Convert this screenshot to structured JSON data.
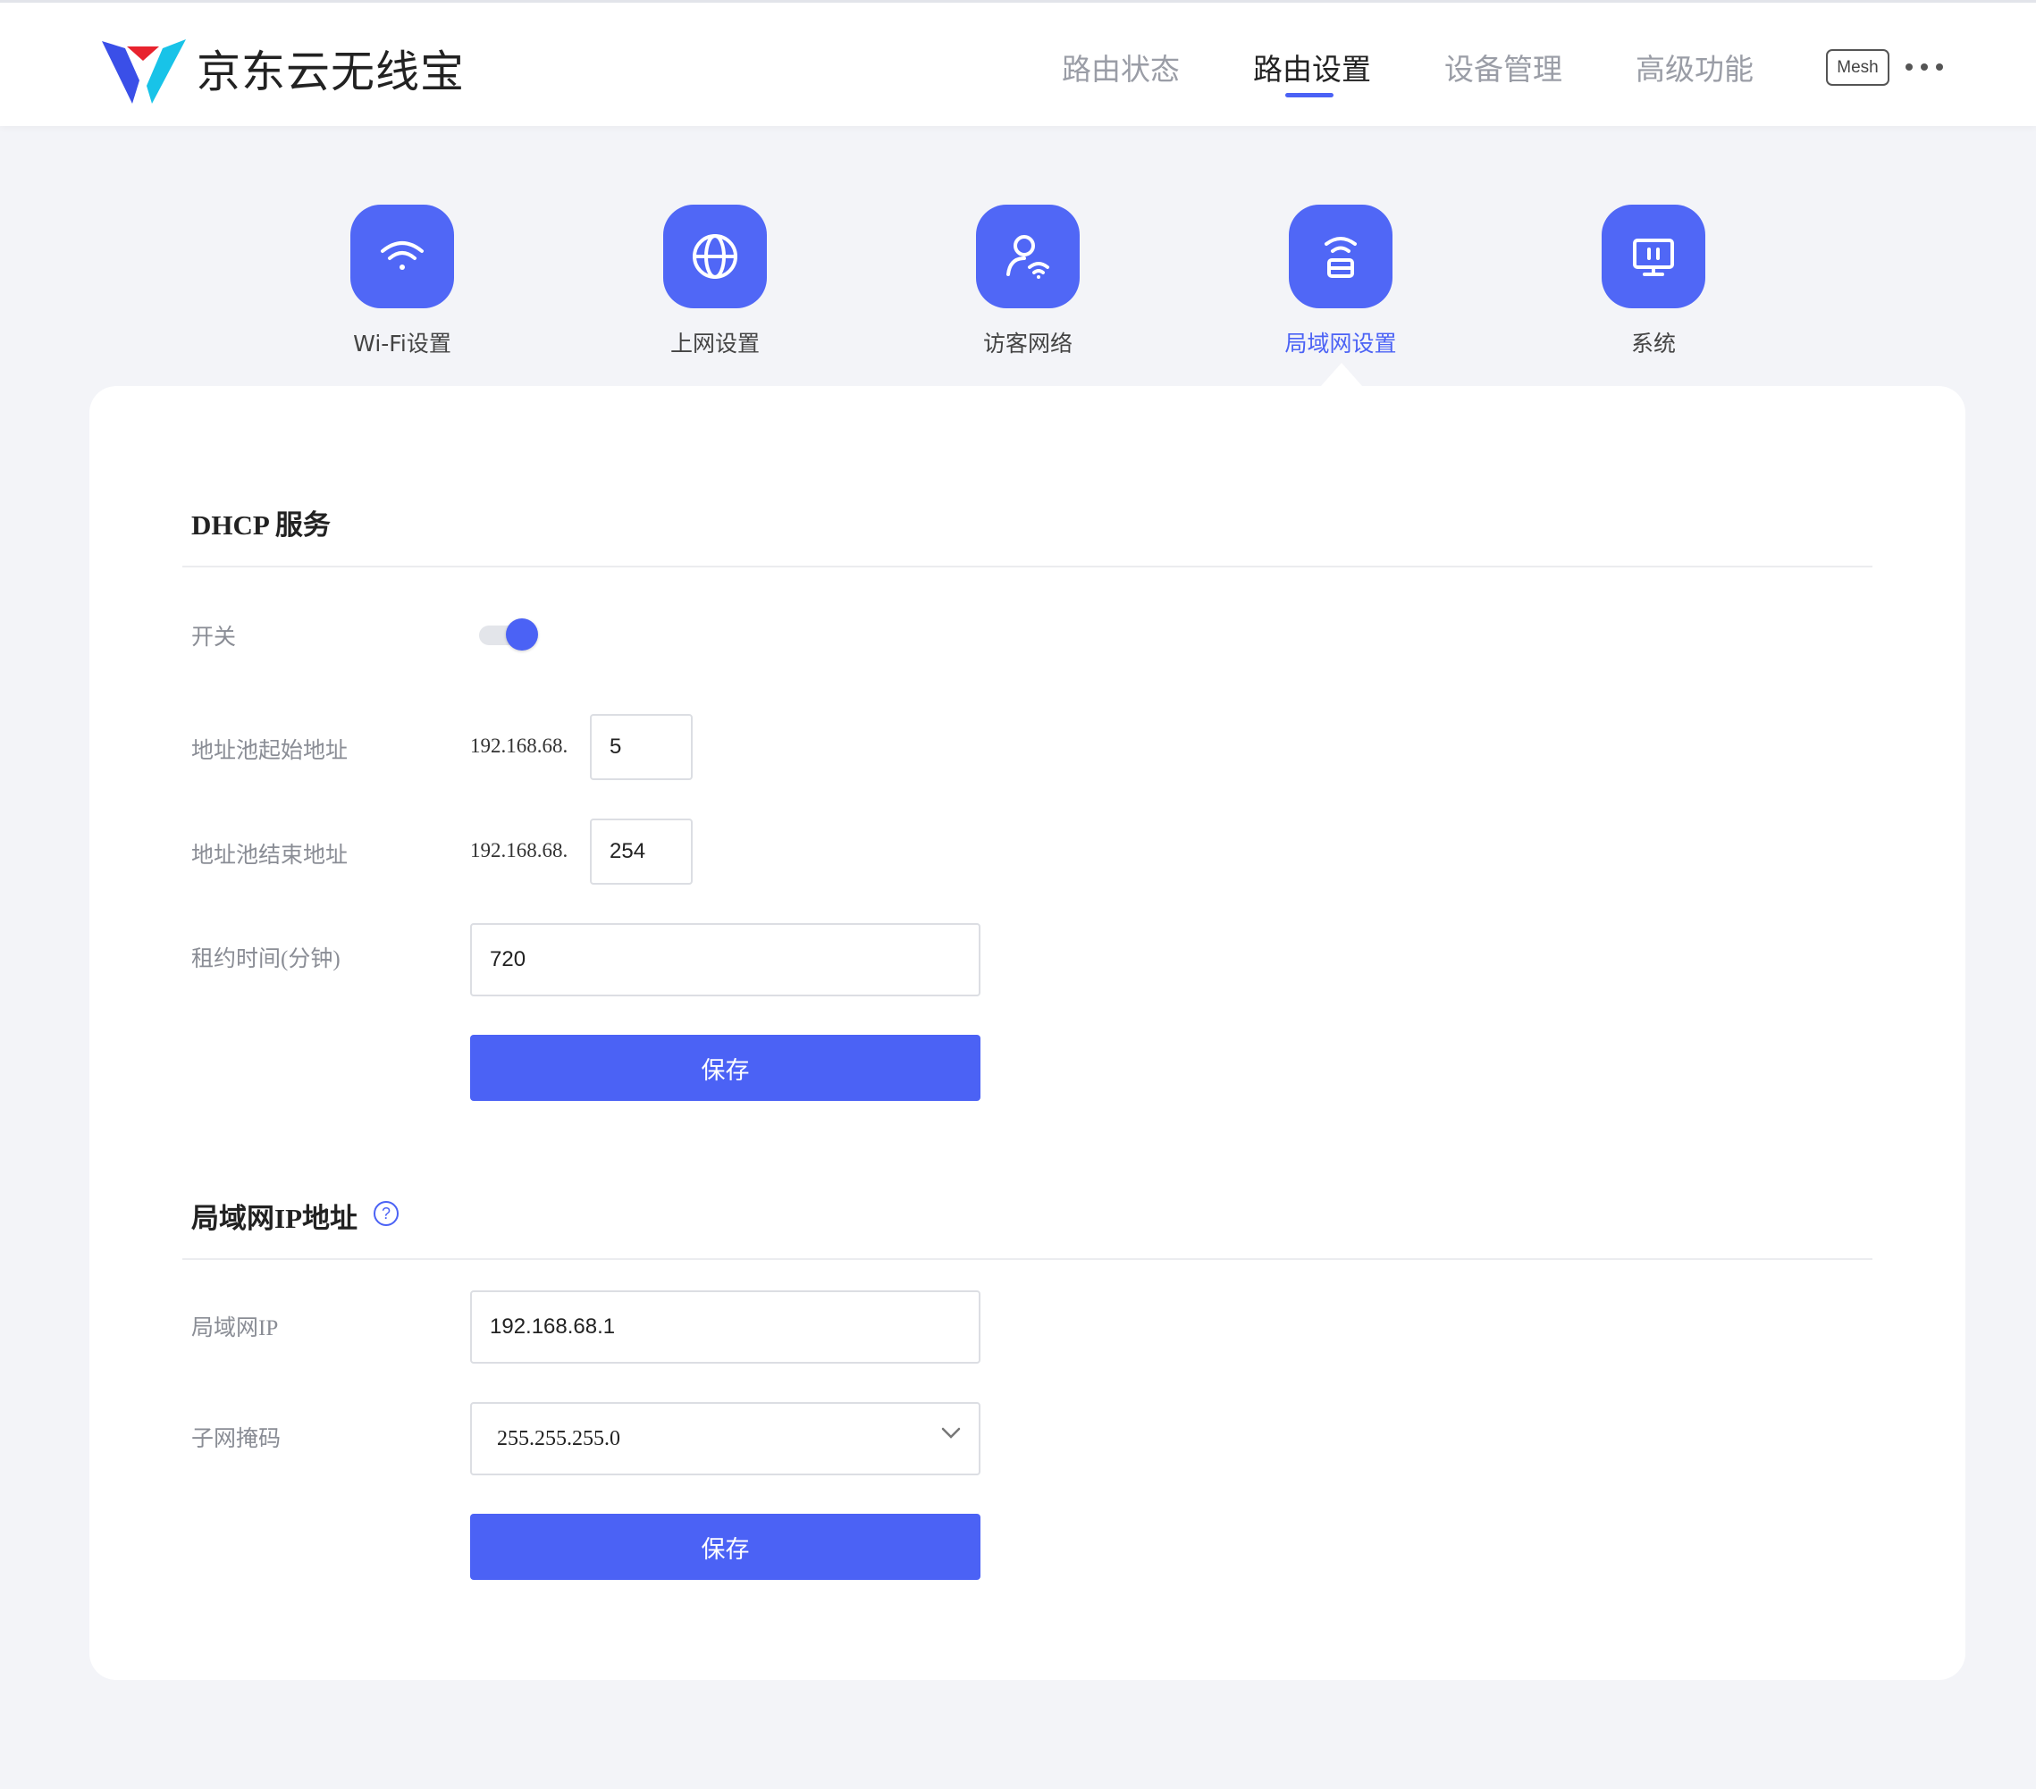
{
  "brand": {
    "name": "京东云无线宝"
  },
  "nav": {
    "items": [
      "路由状态",
      "路由设置",
      "设备管理",
      "高级功能"
    ],
    "active": "路由设置",
    "mesh_label": "Mesh"
  },
  "categories": [
    {
      "label": "Wi-Fi设置",
      "icon": "wifi-icon"
    },
    {
      "label": "上网设置",
      "icon": "globe-icon"
    },
    {
      "label": "访客网络",
      "icon": "guest-user-icon"
    },
    {
      "label": "局域网设置",
      "icon": "router-icon",
      "active": true
    },
    {
      "label": "系统",
      "icon": "monitor-icon"
    }
  ],
  "dhcp": {
    "title": "DHCP 服务",
    "switch_label": "开关",
    "switch_on": true,
    "pool_start_label": "地址池起始地址",
    "pool_start_prefix": "192.168.68.",
    "pool_start_value": "5",
    "pool_end_label": "地址池结束地址",
    "pool_end_prefix": "192.168.68.",
    "pool_end_value": "254",
    "lease_label": "租约时间(分钟)",
    "lease_value": "720",
    "save_label": "保存"
  },
  "lan": {
    "title": "局域网IP地址",
    "help_icon": "help-circle-icon",
    "ip_label": "局域网IP",
    "ip_value": "192.168.68.1",
    "mask_label": "子网掩码",
    "mask_value": "255.255.255.0",
    "save_label": "保存"
  },
  "colors": {
    "accent": "#4b62f5",
    "background": "#f3f4f8",
    "logo_blue": "#3a4fe8",
    "logo_cyan": "#18c3e8",
    "logo_red": "#e8232e"
  }
}
